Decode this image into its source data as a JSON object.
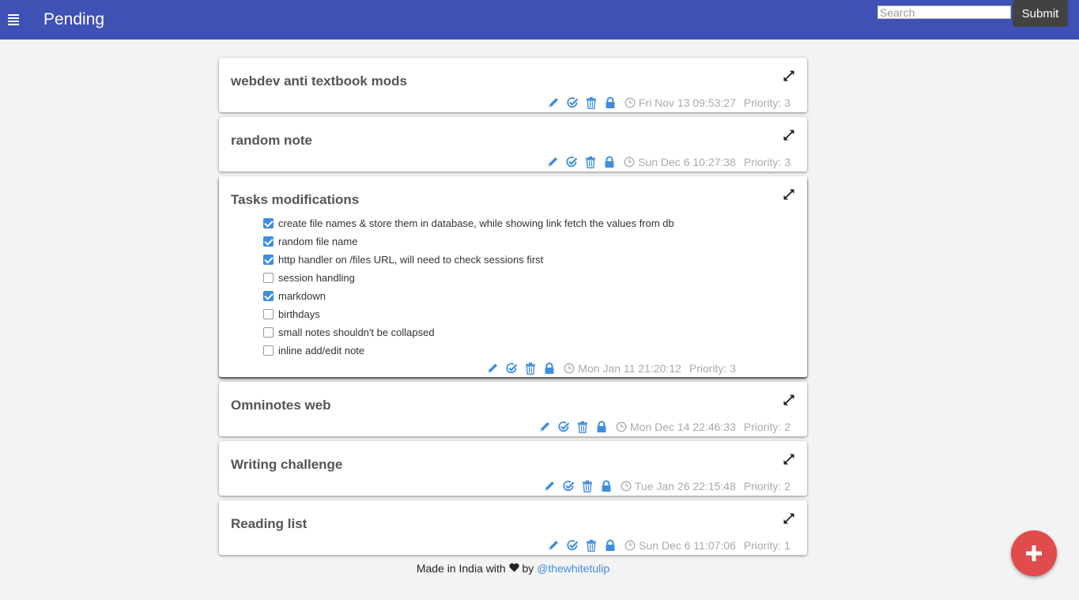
{
  "header": {
    "title": "Pending",
    "search_placeholder": "Search",
    "submit_label": "Submit"
  },
  "notes": [
    {
      "title": "webdev anti textbook mods",
      "date": "Fri Nov 13 09:53:27",
      "priority": "Priority: 3"
    },
    {
      "title": "random note",
      "date": "Sun Dec 6 10:27:38",
      "priority": "Priority: 3"
    },
    {
      "title": "Tasks modifications",
      "date": "Mon Jan 11 21:20:12",
      "priority": "Priority: 3",
      "tasks": [
        {
          "label": "create file names & store them in database, while showing link fetch the values from db",
          "checked": true
        },
        {
          "label": "random file name",
          "checked": true
        },
        {
          "label": "http handler on /files URL, will need to check sessions first",
          "checked": true
        },
        {
          "label": "session handling",
          "checked": false
        },
        {
          "label": "markdown",
          "checked": true
        },
        {
          "label": "birthdays",
          "checked": false
        },
        {
          "label": "small notes shouldn't be collapsed",
          "checked": false
        },
        {
          "label": "inline add/edit note",
          "checked": false
        }
      ]
    },
    {
      "title": "Omninotes web",
      "date": "Mon Dec 14 22:46:33",
      "priority": "Priority: 2"
    },
    {
      "title": "Writing challenge",
      "date": "Tue Jan 26 22:15:48",
      "priority": "Priority: 2"
    },
    {
      "title": "Reading list",
      "date": "Sun Dec 6 11:07:06",
      "priority": "Priority: 1"
    }
  ],
  "footer": {
    "made_in": "Made in India with",
    "by": "by",
    "link_text": "@thewhitetulip"
  },
  "icons": {
    "menu": "menu-icon",
    "expand": "expand-icon",
    "edit": "pencil-icon",
    "done": "check-circle-icon",
    "delete": "trash-icon",
    "lock": "lock-icon",
    "time": "clock-icon",
    "love": "heart-icon",
    "add": "plus-icon"
  },
  "colors": {
    "header_bg": "#3f51b5",
    "accent": "#3e8ede",
    "fab": "#e04b4b",
    "submit_bg": "#424242"
  }
}
